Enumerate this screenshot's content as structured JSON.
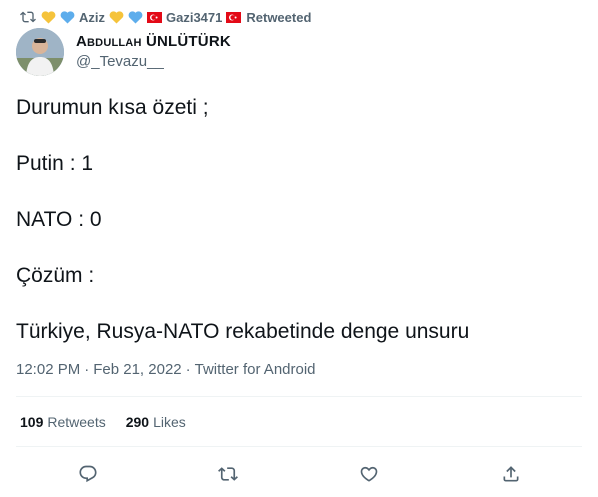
{
  "retweet": {
    "names": [
      "Aziz",
      "Gazi3471"
    ],
    "label": "Retweeted"
  },
  "author": {
    "display_name": "Abdullah ÜNLÜTÜRK",
    "handle": "@_Tevazu__"
  },
  "tweet": {
    "lines": [
      "Durumun kısa özeti ;",
      "Putin : 1",
      "NATO : 0",
      "Çözüm :",
      "Türkiye, Rusya-NATO rekabetinde denge unsuru"
    ]
  },
  "meta": {
    "time": "12:02 PM",
    "sep1": "·",
    "date": "Feb 21, 2022",
    "sep2": "·",
    "source": "Twitter for Android"
  },
  "stats": {
    "retweets_count": "109",
    "retweets_label": "Retweets",
    "likes_count": "290",
    "likes_label": "Likes"
  },
  "icons": {
    "retweet": "retweet-icon",
    "reply": "reply-icon",
    "like": "heart-icon",
    "share": "share-icon"
  },
  "colors": {
    "text": "#0f1419",
    "muted": "#536471",
    "divider": "#eff3f4",
    "yellow_heart": "#f5c33b",
    "blue_heart": "#5dadec",
    "flag_red": "#e30a17"
  }
}
